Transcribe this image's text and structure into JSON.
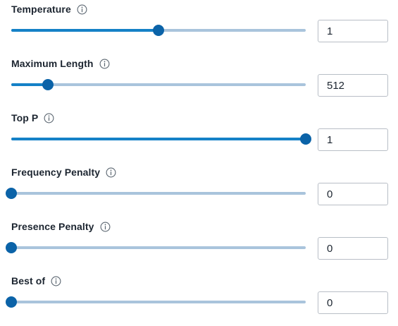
{
  "params": [
    {
      "label": "Temperature",
      "value": "1",
      "level": 0.5
    },
    {
      "label": "Maximum Length",
      "value": "512",
      "level": 0.125
    },
    {
      "label": "Top P",
      "value": "1",
      "level": 1.0
    },
    {
      "label": "Frequency Penalty",
      "value": "0",
      "level": 0.0
    },
    {
      "label": "Presence Penalty",
      "value": "0",
      "level": 0.0
    },
    {
      "label": "Best of",
      "value": "0",
      "level": 0.0
    }
  ],
  "icons": {
    "info": "info-circle-icon"
  },
  "colors": {
    "track": "#a9c4dc",
    "fill": "#1581c7",
    "thumb": "#0b63a8"
  }
}
